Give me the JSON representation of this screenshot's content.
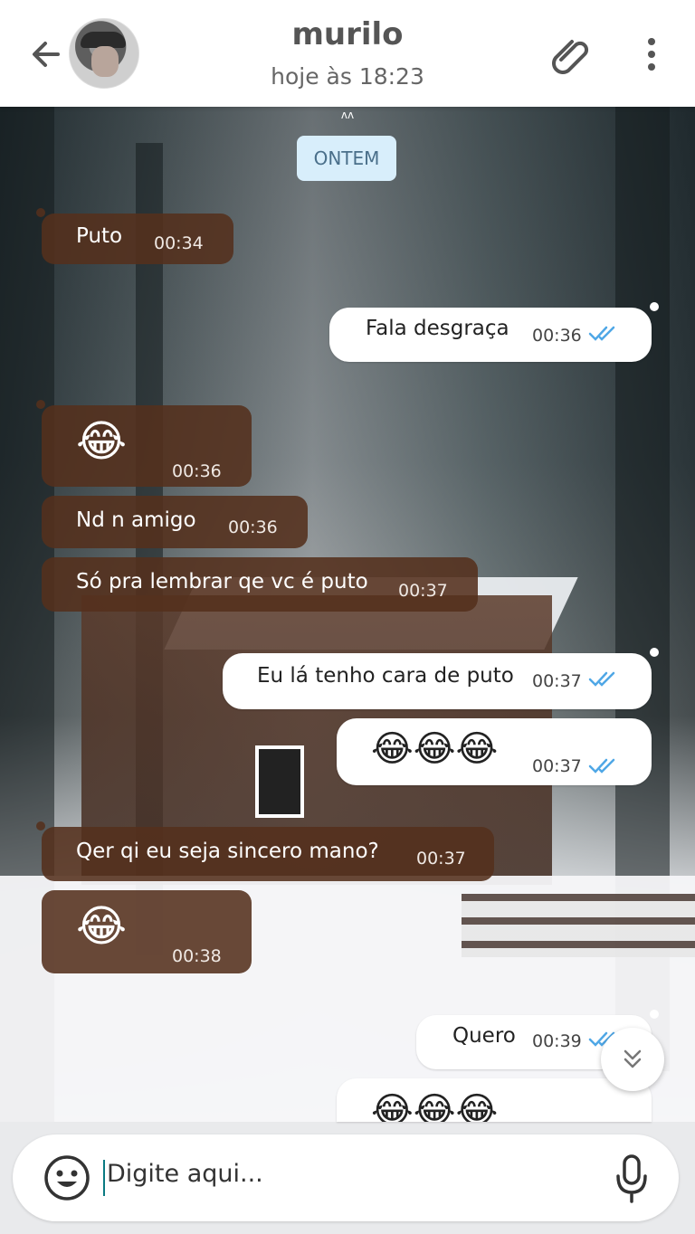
{
  "header": {
    "contact_name": "murilo",
    "status": "hoje às 18:23"
  },
  "chat": {
    "date_label": "ONTEM",
    "messages": [
      {
        "dir": "in",
        "text": "Puto",
        "time": "00:34"
      },
      {
        "dir": "out",
        "text": "Fala desgraça",
        "time": "00:36",
        "ticks": "double-check-blue"
      },
      {
        "dir": "in",
        "text": "😂",
        "time": "00:36"
      },
      {
        "dir": "in",
        "text": "Nd n amigo",
        "time": "00:36"
      },
      {
        "dir": "in",
        "text": "Só pra lembrar qe vc é puto",
        "time": "00:37"
      },
      {
        "dir": "out",
        "text": "Eu lá tenho cara de puto",
        "time": "00:37",
        "ticks": "double-check-blue"
      },
      {
        "dir": "out",
        "text": "😂😂😂",
        "time": "00:37",
        "ticks": "double-check-blue"
      },
      {
        "dir": "in",
        "text": "Qer qi eu seja sincero mano?",
        "time": "00:37"
      },
      {
        "dir": "in",
        "text": "😂",
        "time": "00:38"
      },
      {
        "dir": "out",
        "text": "Quero",
        "time": "00:39",
        "ticks": "double-check-blue"
      },
      {
        "dir": "out",
        "text": "😂😂😂",
        "time": "",
        "ticks": ""
      }
    ]
  },
  "input": {
    "placeholder": "Digite aqui..."
  },
  "icons": {
    "back": "arrow-left-icon",
    "attach": "paperclip-icon",
    "menu": "more-vertical-icon",
    "emoji": "smiley-icon",
    "mic": "microphone-icon",
    "scroll_down": "chevron-double-down-icon"
  },
  "colors": {
    "incoming_bubble": "#54301c",
    "outgoing_bubble": "#ffffff",
    "read_ticks": "#4fa7e6",
    "date_chip": "#d8eefb"
  }
}
